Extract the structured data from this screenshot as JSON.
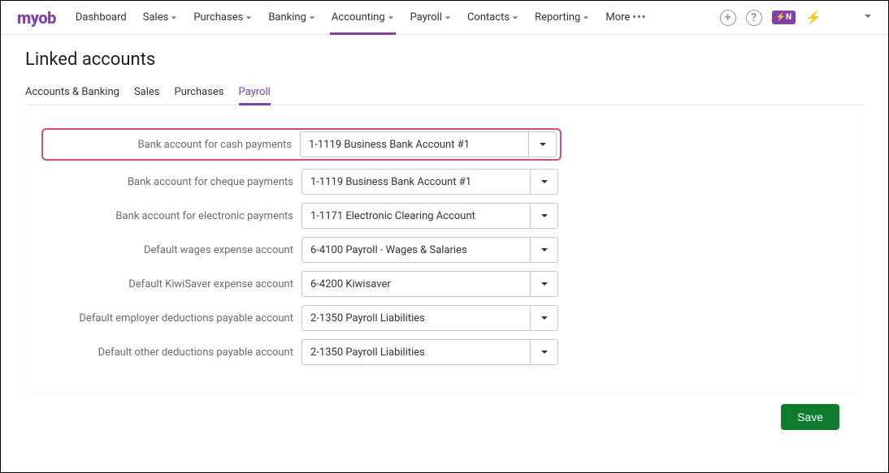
{
  "brand": "myob",
  "nav": {
    "items": [
      {
        "label": "Dashboard",
        "dropdown": false
      },
      {
        "label": "Sales",
        "dropdown": true
      },
      {
        "label": "Purchases",
        "dropdown": true
      },
      {
        "label": "Banking",
        "dropdown": true
      },
      {
        "label": "Accounting",
        "dropdown": true,
        "active": true
      },
      {
        "label": "Payroll",
        "dropdown": true
      },
      {
        "label": "Contacts",
        "dropdown": true
      },
      {
        "label": "Reporting",
        "dropdown": true
      },
      {
        "label": "More",
        "ellipsis": true
      }
    ],
    "badge": "⚡N"
  },
  "page": {
    "title": "Linked accounts",
    "tabs": [
      {
        "label": "Accounts & Banking"
      },
      {
        "label": "Sales"
      },
      {
        "label": "Purchases"
      },
      {
        "label": "Payroll",
        "active": true
      }
    ]
  },
  "fields": [
    {
      "label": "Bank account for cash payments",
      "value": "1-1119  Business Bank Account #1",
      "highlight": true
    },
    {
      "label": "Bank account for cheque payments",
      "value": "1-1119  Business Bank Account #1"
    },
    {
      "label": "Bank account for electronic payments",
      "value": "1-1171  Electronic Clearing Account"
    },
    {
      "label": "Default wages expense account",
      "value": "6-4100  Payroll - Wages & Salaries"
    },
    {
      "label": "Default KiwiSaver expense account",
      "value": "6-4200  Kiwisaver"
    },
    {
      "label": "Default employer deductions payable account",
      "value": "2-1350  Payroll Liabilities"
    },
    {
      "label": "Default other deductions payable account",
      "value": "2-1350  Payroll Liabilities"
    }
  ],
  "actions": {
    "save": "Save"
  }
}
